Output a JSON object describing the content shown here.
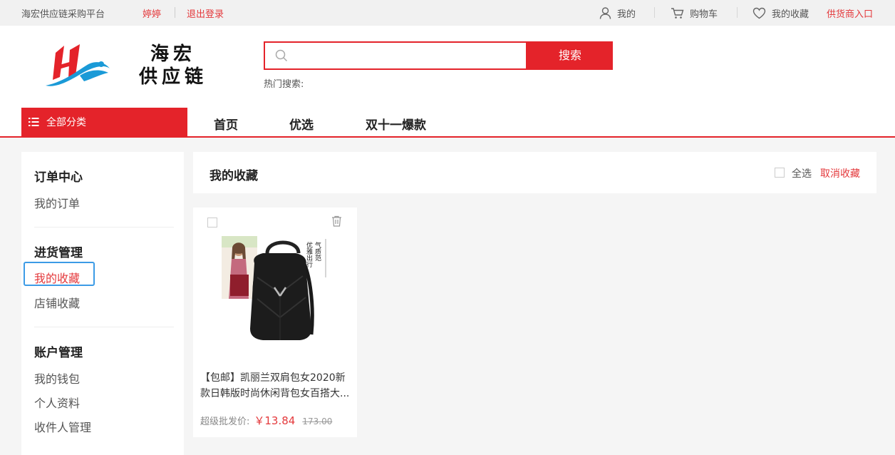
{
  "topbar": {
    "site_name": "海宏供应链采购平台",
    "username": "婷婷",
    "logout": "退出登录",
    "my": "我的",
    "cart": "购物车",
    "favorites": "我的收藏",
    "supplier_entry": "供货商入口"
  },
  "header": {
    "brand_line1": "海宏",
    "brand_line2": "供应链",
    "search_placeholder": "",
    "search_button": "搜索",
    "hot_search_label": "热门搜索:"
  },
  "nav": {
    "all_categories": "全部分类",
    "items": [
      "首页",
      "优选",
      "双十一爆款"
    ]
  },
  "sidebar": {
    "groups": [
      {
        "title": "订单中心",
        "items": [
          "我的订单"
        ]
      },
      {
        "title": "进货管理",
        "items": [
          "我的收藏",
          "店铺收藏"
        ]
      },
      {
        "title": "账户管理",
        "items": [
          "我的钱包",
          "个人资料",
          "收件人管理"
        ]
      }
    ],
    "active_item": "我的收藏"
  },
  "main": {
    "title": "我的收藏",
    "select_all": "全选",
    "cancel_favorite": "取消收藏",
    "products": [
      {
        "name": "【包邮】凯丽兰双肩包女2020新款日韩版时尚休闲背包女百搭大...",
        "price_label": "超级批发价:",
        "price": "￥13.84",
        "original_price": "173.00",
        "image_text": [
          "优雅出行",
          "气质范"
        ]
      }
    ]
  },
  "colors": {
    "brand_red": "#e4232a",
    "link_red": "#e4393c",
    "focus_blue": "#3c9be6"
  }
}
